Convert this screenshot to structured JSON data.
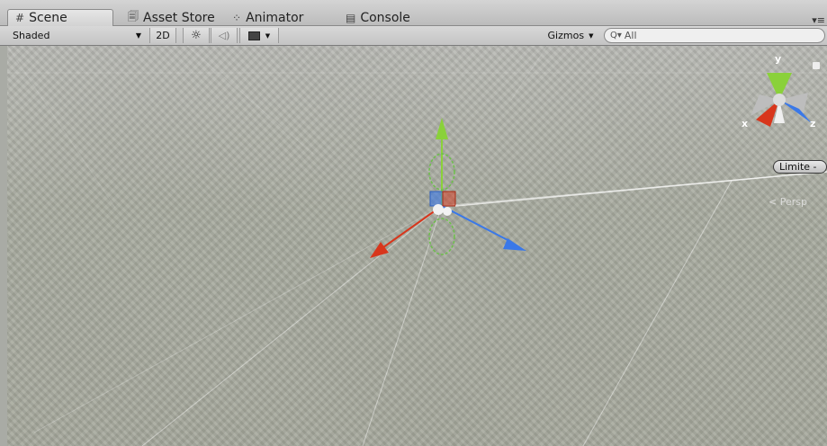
{
  "tabs": [
    {
      "label": "Scene",
      "icon": "hash-icon",
      "glyph": "#"
    },
    {
      "label": "Asset Store",
      "icon": "store-icon",
      "glyph": "🗐"
    },
    {
      "label": "Animator",
      "icon": "animator-icon",
      "glyph": "⁘"
    },
    {
      "label": "Console",
      "icon": "console-icon",
      "glyph": "▤"
    }
  ],
  "toolbar": {
    "shading_mode": "Shaded",
    "mode_2d": "2D",
    "gizmos_label": "Gizmos",
    "search_placeholder": "All"
  },
  "scene": {
    "axis_y": "y",
    "axis_x": "x",
    "axis_z": "z",
    "projection": "Persp",
    "limit_label": "Limite - "
  },
  "colors": {
    "axis_x": "#d8361c",
    "axis_y": "#8ad13a",
    "axis_z": "#3a78e8"
  }
}
